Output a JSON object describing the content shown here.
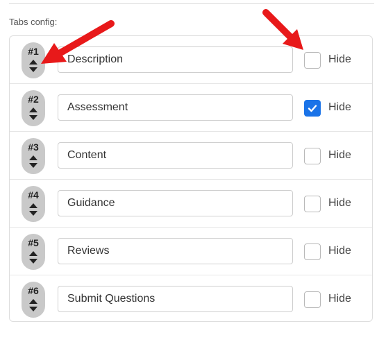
{
  "section_label": "Tabs config:",
  "hide_label": "Hide",
  "colors": {
    "accent": "#1a73e8",
    "annotation_arrow": "#e8191a",
    "handle": "#c9c9c9"
  },
  "tabs": [
    {
      "order": "#1",
      "name": "Description",
      "hidden": false
    },
    {
      "order": "#2",
      "name": "Assessment",
      "hidden": true
    },
    {
      "order": "#3",
      "name": "Content",
      "hidden": false
    },
    {
      "order": "#4",
      "name": "Guidance",
      "hidden": false
    },
    {
      "order": "#5",
      "name": "Reviews",
      "hidden": false
    },
    {
      "order": "#6",
      "name": "Submit Questions",
      "hidden": false
    }
  ]
}
